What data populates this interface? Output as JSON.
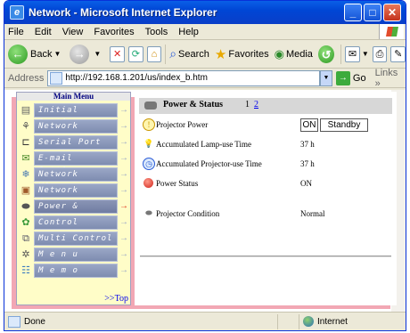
{
  "window": {
    "title": "Network - Microsoft Internet Explorer"
  },
  "menubar": {
    "items": [
      "File",
      "Edit",
      "View",
      "Favorites",
      "Tools",
      "Help"
    ]
  },
  "toolbar": {
    "back_label": "Back",
    "search_label": "Search",
    "favorites_label": "Favorites",
    "media_label": "Media"
  },
  "address": {
    "label": "Address",
    "url": "http://192.168.1.201/us/index_b.htm",
    "go_label": "Go",
    "links_label": "Links"
  },
  "sidebar": {
    "heading": "Main Menu",
    "items": [
      {
        "label": "Initial Setting",
        "icon": "initial-setting-icon"
      },
      {
        "label": "Network",
        "icon": "network-icon"
      },
      {
        "label": "Serial Port",
        "icon": "serial-port-icon"
      },
      {
        "label": "E-mail Setting",
        "icon": "email-icon"
      },
      {
        "label": "Network Viewer",
        "icon": "network-viewer-icon"
      },
      {
        "label": "Network Capture",
        "icon": "network-capture-icon"
      },
      {
        "label": "Power & Status",
        "icon": "projector-icon"
      },
      {
        "label": "Control",
        "icon": "control-icon"
      },
      {
        "label": "Multi Control",
        "icon": "multi-control-icon"
      },
      {
        "label": "M e n u",
        "icon": "menu-icon"
      },
      {
        "label": "M e m o",
        "icon": "memo-icon"
      }
    ],
    "to_top": ">>Top"
  },
  "content": {
    "title": "Power & Status",
    "page_current": "1",
    "page_link": "2",
    "rows": {
      "power": {
        "label": "Projector Power",
        "on": "ON",
        "standby": "Standby"
      },
      "lamp": {
        "label": "Accumulated Lamp-use Time",
        "value": "37 h"
      },
      "projector_time": {
        "label": "Accumulated Projector-use Time",
        "value": "37 h"
      },
      "status": {
        "label": "Power Status",
        "value": "ON"
      },
      "condition": {
        "label": "Projector Condition",
        "value": "Normal"
      }
    }
  },
  "statusbar": {
    "status": "Done",
    "zone": "Internet"
  }
}
